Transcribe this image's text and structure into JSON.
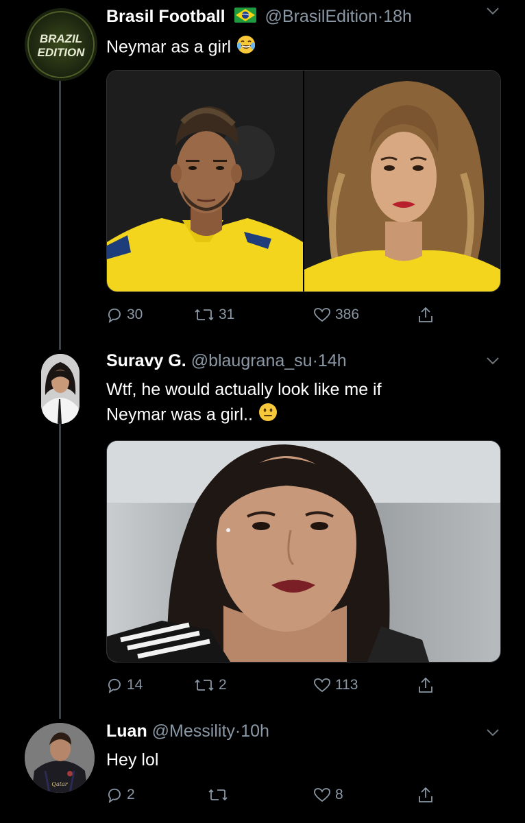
{
  "tweets": [
    {
      "name": "Brasil Football",
      "flag": "brazil-flag",
      "handle": "@BrasilEdition",
      "sep": "·",
      "time": "18h",
      "text_before_emoji": "Neymar as a girl ",
      "emoji": "laughing-tears-emoji",
      "avatar_lines": [
        "BRAZIL",
        "EDITION"
      ],
      "counts": {
        "reply": "30",
        "retweet": "31",
        "like": "386"
      }
    },
    {
      "name": "Suravy G.",
      "handle": "@blaugrana_su",
      "sep": "·",
      "time": "14h",
      "line1": "Wtf, he would actually look like me if",
      "line2_before_emoji": "Neymar was a girl..",
      "emoji": "neutral-face-emoji",
      "counts": {
        "reply": "14",
        "retweet": "2",
        "like": "113"
      }
    },
    {
      "name": "Luan",
      "handle": "@Messility",
      "sep": "·",
      "time": "10h",
      "text": "Hey lol",
      "counts": {
        "reply": "2",
        "retweet": "",
        "like": "8"
      }
    }
  ],
  "colors": {
    "background": "#000000",
    "secondary_text": "#8b98a5",
    "thread_line": "#3d4145",
    "jersey_yellow": "#f2d51c"
  }
}
